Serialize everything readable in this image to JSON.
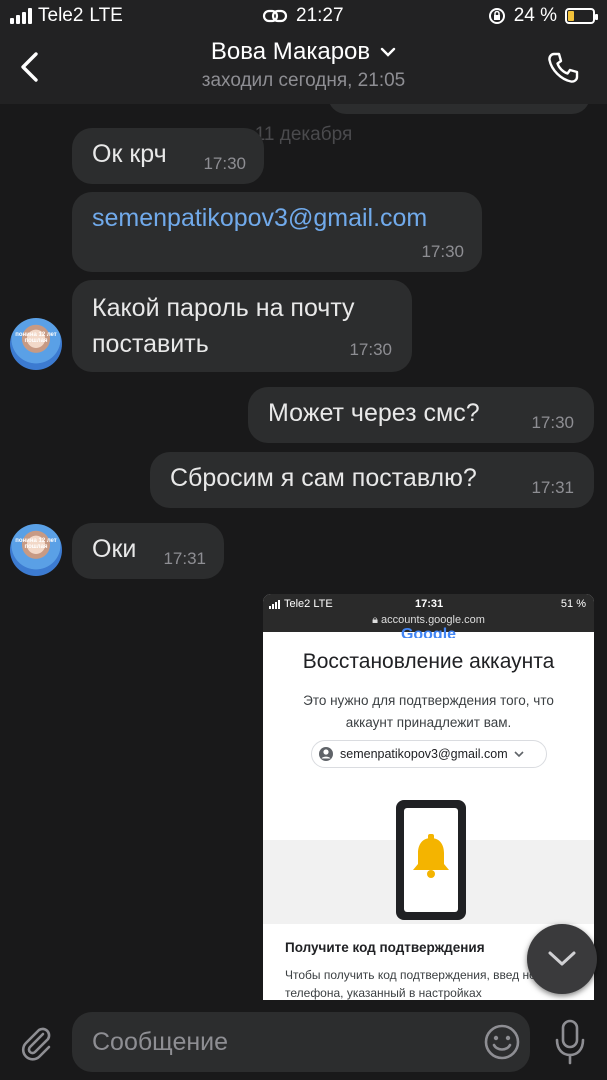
{
  "status_bar": {
    "carrier": "Tele2",
    "network": "LTE",
    "time": "21:27",
    "battery": "24 %",
    "battery_level": 0.24
  },
  "header": {
    "contact_name": "Вова Макаров",
    "last_seen": "заходил сегодня, 21:05"
  },
  "date_separator": "11 декабря",
  "avatar_caption": "понина 12 лет пошлая",
  "messages": [
    {
      "text": "Ок крч",
      "time": "17:30",
      "direction": "in"
    },
    {
      "text": "semenpatikopov3@gmail.com",
      "time": "17:30",
      "direction": "in",
      "is_link": true
    },
    {
      "text_line1": "Какой пароль на почту",
      "text_line2": "поставить",
      "time": "17:30",
      "direction": "in"
    },
    {
      "text": "Может через смс?",
      "time": "17:30",
      "direction": "out"
    },
    {
      "text": "Сбросим я сам поставлю?",
      "time": "17:31",
      "direction": "out"
    },
    {
      "text": "Оки",
      "time": "17:31",
      "direction": "in"
    }
  ],
  "attachment": {
    "status_carrier": "Tele2 LTE",
    "status_time": "17:31",
    "status_battery": "51 %",
    "url": "accounts.google.com",
    "logo": "Google",
    "title": "Восстановление аккаунта",
    "description": "Это нужно для подтверждения того, что аккаунт принадлежит вам.",
    "email_chip": "semenpatikopov3@gmail.com",
    "subheading": "Получите код подтверждения",
    "body": "Чтобы получить код подтверждения, введ номер телефона, указанный в настройках"
  },
  "composer": {
    "placeholder": "Сообщение"
  },
  "colors": {
    "background": "#19191a",
    "bubble": "#2c2d2e",
    "link": "#71aaeb",
    "time": "#8e8e93",
    "bell": "#f4b400"
  }
}
